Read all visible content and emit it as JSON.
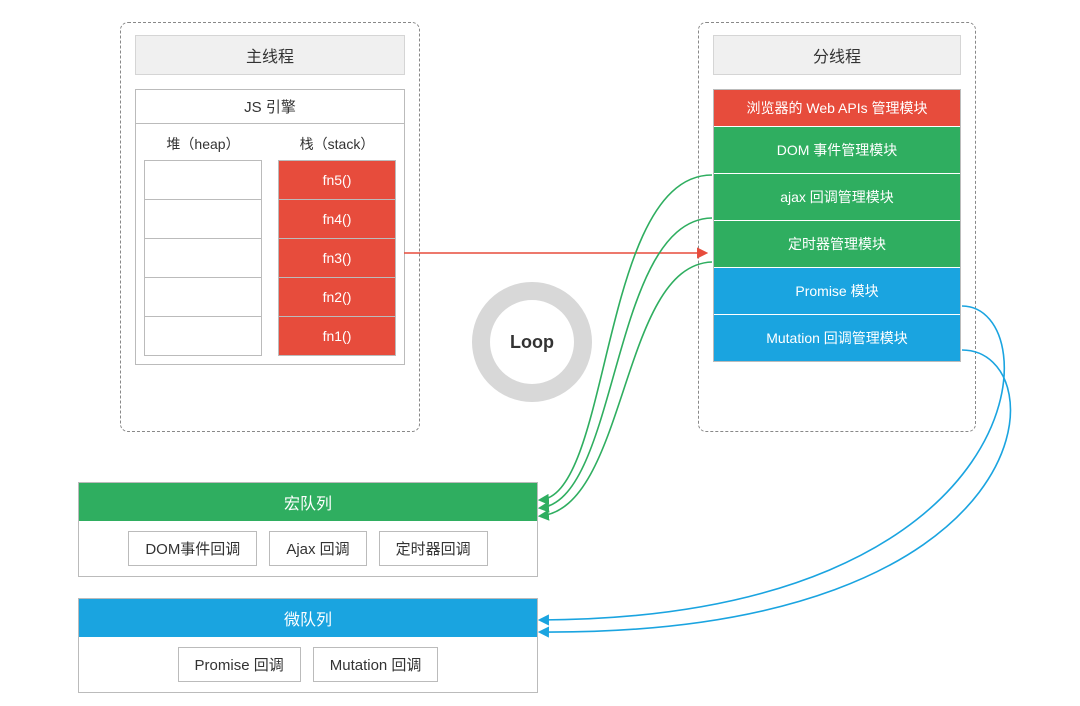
{
  "main_thread": {
    "title": "主线程",
    "engine_title": "JS 引擎",
    "heap_label": "堆（heap）",
    "stack_label": "栈（stack）",
    "stack_frames": [
      "fn5()",
      "fn4()",
      "fn3()",
      "fn2()",
      "fn1()"
    ]
  },
  "worker_thread": {
    "title": "分线程",
    "api_header": "浏览器的 Web APIs 管理模块",
    "modules": [
      {
        "label": "DOM 事件管理模块",
        "kind": "green"
      },
      {
        "label": "ajax 回调管理模块",
        "kind": "green"
      },
      {
        "label": "定时器管理模块",
        "kind": "green"
      },
      {
        "label": "Promise 模块",
        "kind": "blue"
      },
      {
        "label": "Mutation 回调管理模块",
        "kind": "blue"
      }
    ]
  },
  "loop": {
    "label": "Loop"
  },
  "macro_queue": {
    "title": "宏队列",
    "items": [
      "DOM事件回调",
      "Ajax 回调",
      "定时器回调"
    ]
  },
  "micro_queue": {
    "title": "微队列",
    "items": [
      "Promise 回调",
      "Mutation 回调"
    ]
  },
  "colors": {
    "red": "#e74c3c",
    "green": "#2fae60",
    "blue": "#1aa4e0"
  }
}
